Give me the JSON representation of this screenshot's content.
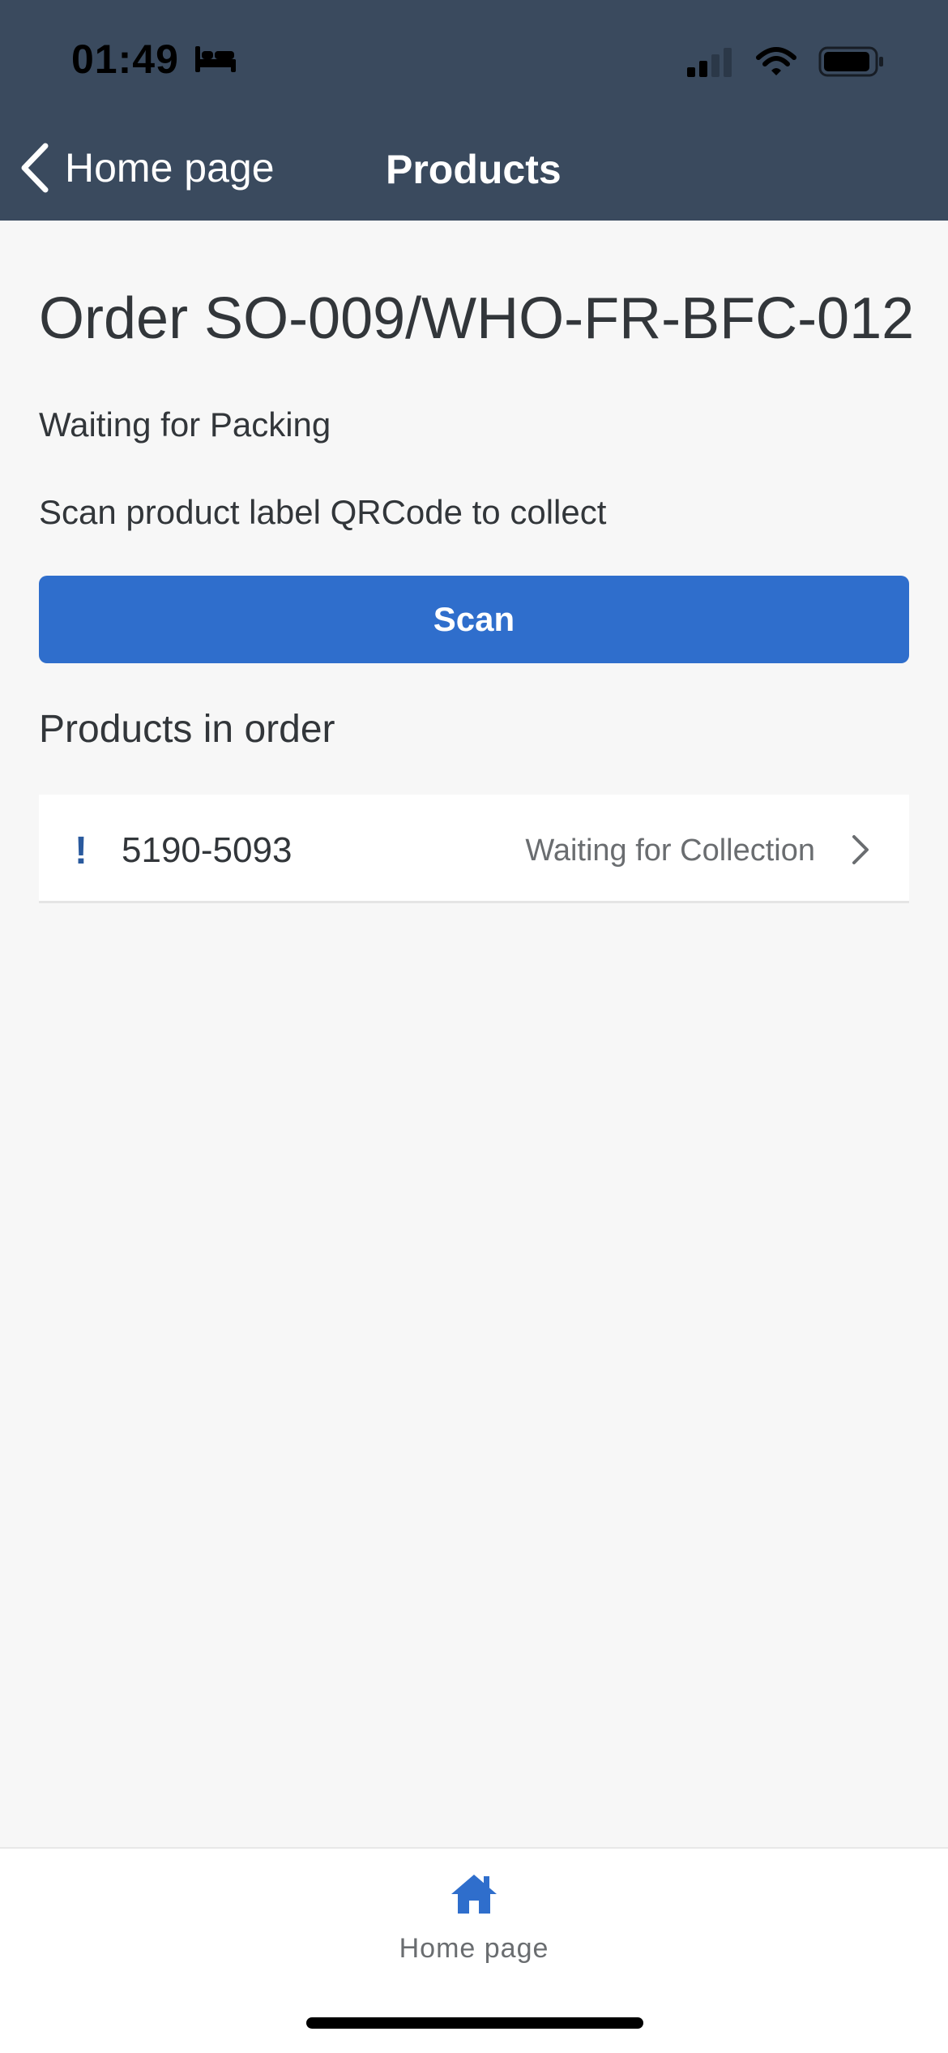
{
  "status_bar": {
    "time": "01:49",
    "sleep_icon": "bed-icon",
    "signal_icon": "cellular-signal-icon",
    "wifi_icon": "wifi-icon",
    "battery_icon": "battery-icon"
  },
  "nav": {
    "back_label": "Home page",
    "title": "Products"
  },
  "order": {
    "title": "Order SO-009/WHO-FR-BFC-012",
    "status": "Waiting for Packing",
    "instruction": "Scan product label QRCode to collect",
    "scan_label": "Scan"
  },
  "products_section": {
    "title": "Products in order",
    "items": [
      {
        "priority_glyph": "!",
        "id": "5190-5093",
        "status": "Waiting for Collection"
      }
    ]
  },
  "tabbar": {
    "home_label": "Home page"
  },
  "colors": {
    "header": "#3a4a5e",
    "accent": "#2f6ecc",
    "background": "#f7f7f7",
    "priority": "#2a5a9e"
  }
}
